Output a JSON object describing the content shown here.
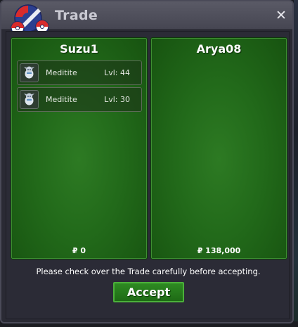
{
  "window": {
    "title": "Trade",
    "close_symbol": "✕"
  },
  "trade": {
    "left": {
      "player": "Suzu1",
      "items": [
        {
          "name": "Meditite",
          "level": "Lvl: 44",
          "icon": "meditite-icon"
        },
        {
          "name": "Meditite",
          "level": "Lvl: 30",
          "icon": "meditite-icon"
        }
      ],
      "money": "₽ 0"
    },
    "right": {
      "player": "Arya08",
      "items": [],
      "money": "₽ 138,000"
    }
  },
  "note": "Please check over the Trade carefully before accepting.",
  "accept_label": "Accept",
  "colors": {
    "panel_green": "#226a1a",
    "accept_green": "#2e8a22"
  }
}
